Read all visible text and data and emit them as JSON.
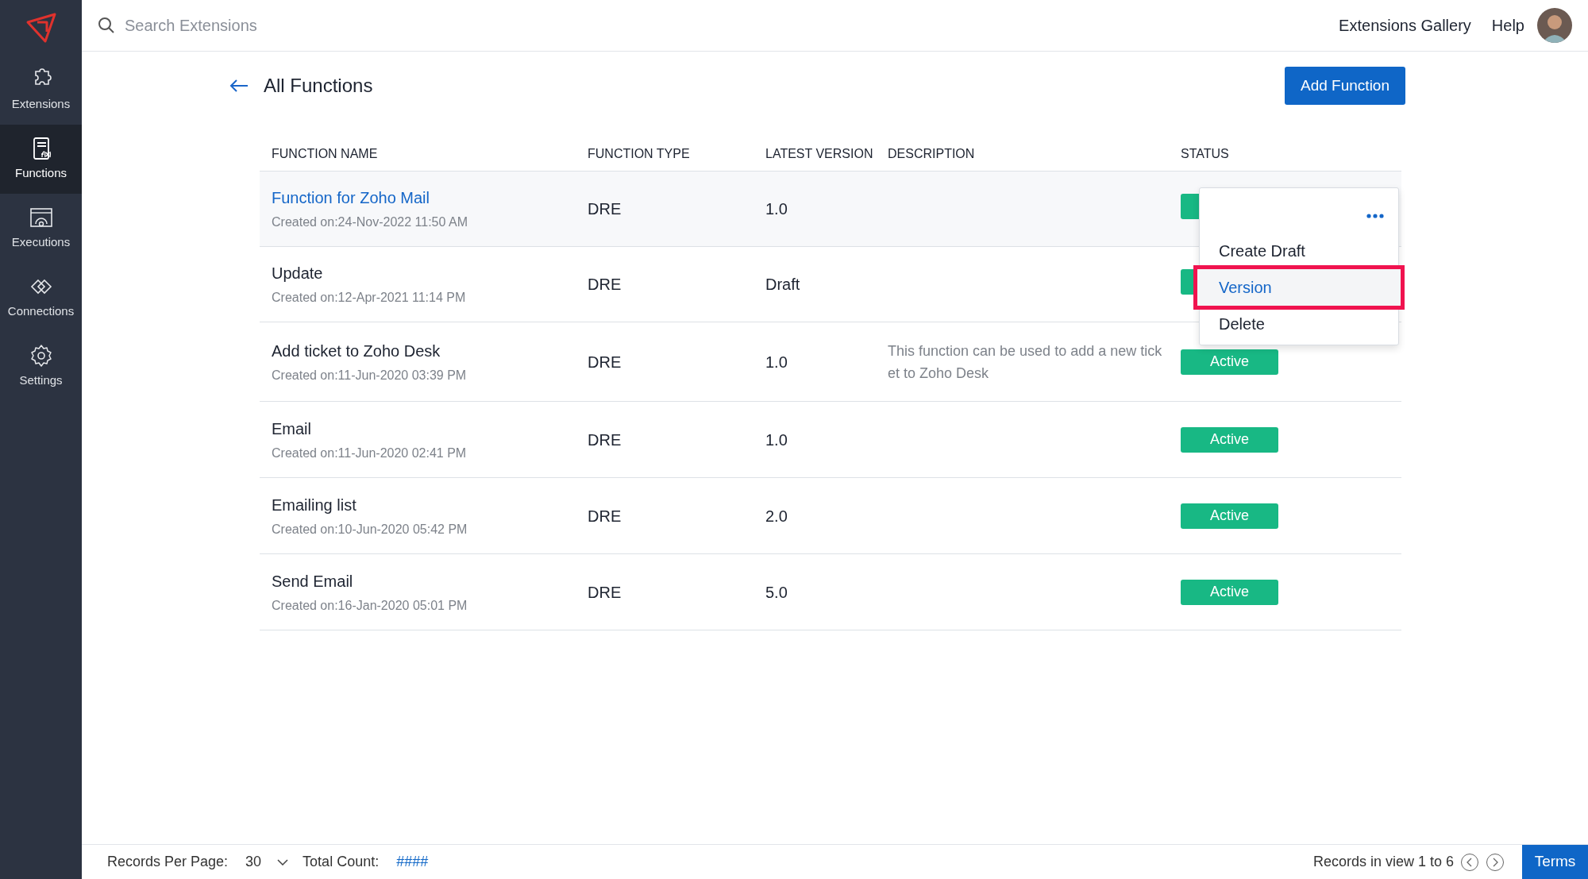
{
  "sidebar": {
    "items": [
      {
        "label": "Extensions",
        "kind": "puzzle",
        "selected": false
      },
      {
        "label": "Functions",
        "kind": "function",
        "selected": true
      },
      {
        "label": "Executions",
        "kind": "executions",
        "selected": false
      },
      {
        "label": "Connections",
        "kind": "connections",
        "selected": false
      },
      {
        "label": "Settings",
        "kind": "settings",
        "selected": false
      }
    ]
  },
  "top_bar": {
    "search": {
      "placeholder": "Search Extensions"
    },
    "links": [
      "Extensions Gallery",
      "Help"
    ]
  },
  "page": {
    "title": "All Functions",
    "primary_button": "Add Function"
  },
  "table": {
    "columns": [
      "FUNCTION NAME",
      "FUNCTION TYPE",
      "LATEST VERSION",
      "DESCRIPTION",
      "STATUS"
    ],
    "rows": [
      {
        "name": "Function for Zoho Mail",
        "created": "Created on:24-Nov-2022 11:50 AM",
        "type": "DRE",
        "version": "1.0",
        "selected": true,
        "status": {}
      },
      {
        "name": "Update",
        "created": "Created on:12-Apr-2021 11:14 PM",
        "type": "DRE",
        "version": "Draft",
        "selected": false,
        "status": {}
      },
      {
        "name": "Add ticket to Zoho Desk",
        "created": "Created on:11-Jun-2020 03:39 PM",
        "type": "DRE",
        "version": "1.0",
        "description": "This function can be used to add a new ticket to Zoho Desk",
        "selected": false,
        "status": {
          "label": "Active"
        }
      },
      {
        "name": "Email",
        "created": "Created on:11-Jun-2020 02:41 PM",
        "type": "DRE",
        "version": "1.0",
        "selected": false,
        "status": {
          "label": "Active"
        }
      },
      {
        "name": "Emailing list",
        "created": "Created on:10-Jun-2020 05:42 PM",
        "type": "DRE",
        "version": "2.0",
        "selected": false,
        "status": {
          "label": "Active"
        }
      },
      {
        "name": "Send Email",
        "created": "Created on:16-Jan-2020 05:01 PM",
        "type": "DRE",
        "version": "5.0",
        "selected": false,
        "status": {
          "label": "Active"
        }
      }
    ]
  },
  "row_menu": {
    "items": [
      {
        "label": "Create Draft",
        "selected": false
      },
      {
        "label": "Version",
        "selected": true
      },
      {
        "label": "Delete",
        "selected": false
      }
    ]
  },
  "footer": {
    "per_page_label": "Records Per Page:",
    "per_page": "30",
    "total_label": "Total Count:",
    "total": "####",
    "range": "Records in view 1 to 6",
    "terms": "Terms"
  }
}
